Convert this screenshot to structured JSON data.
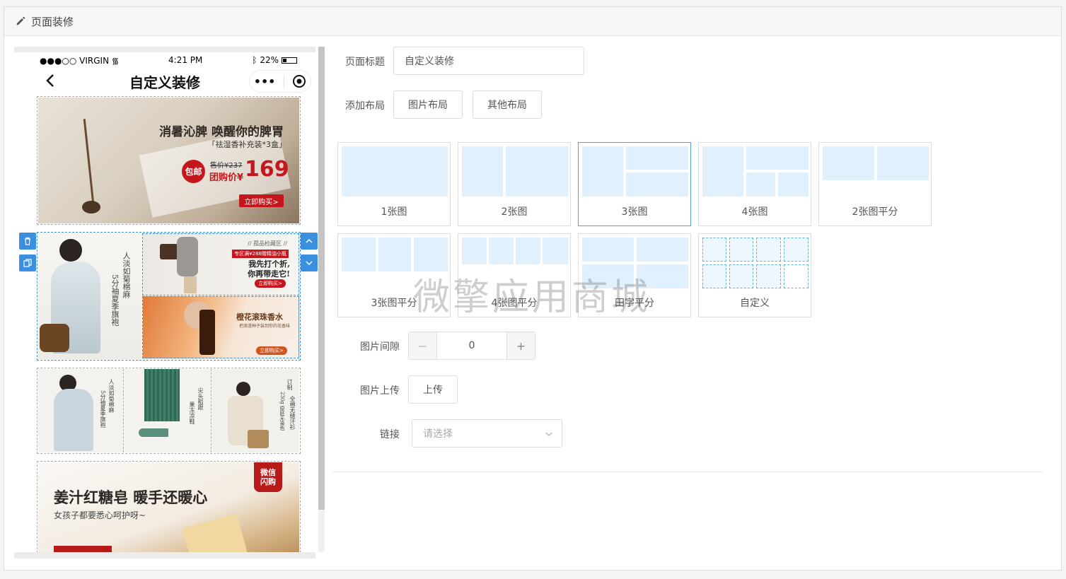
{
  "header": {
    "title": "页面装修"
  },
  "phone": {
    "status": {
      "carrier": "●●●○○ VIRGIN",
      "time": "4:21 PM",
      "battery": "22%"
    },
    "nav_title": "自定义装修",
    "banner1": {
      "headline": "消暑沁脾 唤醒你的脾胃",
      "sub": "「祛湿香补充装*3盒」",
      "badge": "包邮",
      "orig_price": "售价¥237",
      "group_label": "团购价¥",
      "price": "169",
      "cta": "立即购买>"
    },
    "banner2": {
      "vtext_a": "人淡如菊棉麻",
      "vtext_b": "5分袖夏季旗袍",
      "promo_top": "// 孤品检藏区 //",
      "promo_badge": "专区满¥288赠精油小瓶",
      "promo_line1": "我先打个折,",
      "promo_line2": "你再带走它!",
      "promo_cta": "立即购买>",
      "oil_title": "橙花滚珠香水",
      "oil_sub": "把浪漫种子装到你的花香味",
      "oil_cta": "立即购买>"
    },
    "banner3": {
      "col1_a": "人淡如菊棉麻",
      "col1_b": "5分袖夏季旗袍",
      "col2_a": "尖头粗跟",
      "col2_b": "果冻凉鞋",
      "col3_a": "订制",
      "col3_b": "230g 原胚无染色",
      "col3_c": "全棉无缝汗衫"
    },
    "banner4": {
      "badge_line1": "微信",
      "badge_line2": "闪购",
      "headline": "姜汁红糖皂 暖手还暖心",
      "sub": "女孩子都要悉心呵护呀~"
    }
  },
  "form": {
    "title_label": "页面标题",
    "title_value": "自定义装修",
    "layout_label": "添加布局",
    "layout_buttons": [
      "图片布局",
      "其他布局"
    ],
    "layouts": [
      "1张图",
      "2张图",
      "3张图",
      "4张图",
      "2张图平分",
      "3张图平分",
      "4张图平分",
      "田字平分",
      "自定义"
    ],
    "active_layout": "3张图",
    "gap_label": "图片间隙",
    "gap_minus": "−",
    "gap_value": "0",
    "gap_plus": "+",
    "upload_label": "图片上传",
    "upload_button": "上传",
    "link_label": "链接",
    "link_placeholder": "请选择"
  },
  "watermark": "微擎应用商城",
  "colors": {
    "accent": "#3b8fe0",
    "cell": "#e0f0fc",
    "price_red": "#c4161c"
  }
}
